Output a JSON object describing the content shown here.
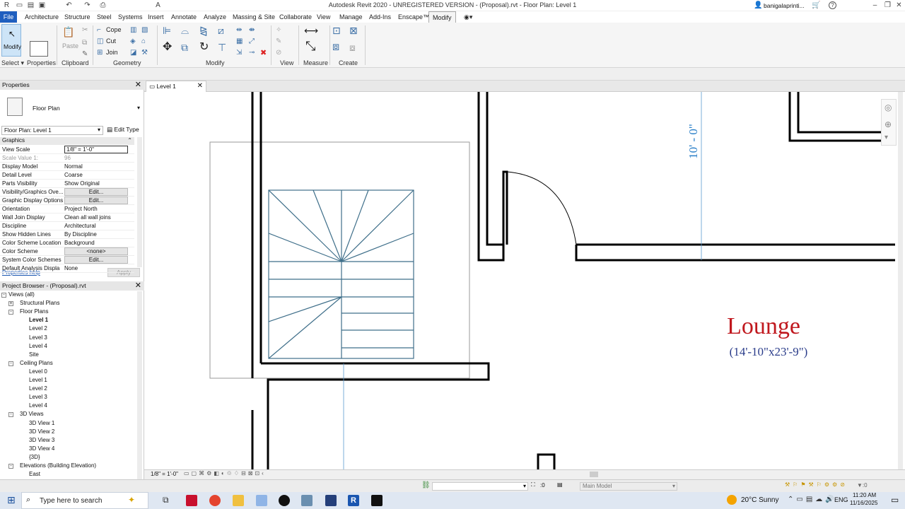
{
  "window": {
    "title": "Autodesk Revit 2020 - UNREGISTERED VERSION - (Proposal).rvt - Floor Plan: Level 1",
    "user": "banigalaprinti...",
    "help": "?"
  },
  "menu": [
    "File",
    "Architecture",
    "Structure",
    "Steel",
    "Systems",
    "Insert",
    "Annotate",
    "Analyze",
    "Massing & Site",
    "Collaborate",
    "View",
    "Manage",
    "Add-Ins",
    "Enscape™",
    "Modify"
  ],
  "ribbon": {
    "modify_label": "Modify",
    "select_label": "Select",
    "properties_label": "Properties",
    "paste_label": "Paste",
    "cope_label": "Cope",
    "cut_label": "Cut",
    "join_label": "Join",
    "panels": [
      "Clipboard",
      "Geometry",
      "Modify",
      "View",
      "Measure",
      "Create"
    ]
  },
  "properties": {
    "title": "Properties",
    "type_name": "Floor Plan",
    "instance": "Floor Plan: Level 1",
    "edit_type": "Edit Type",
    "group": "Graphics",
    "rows": [
      {
        "k": "View Scale",
        "v": "1/8\" = 1'-0\""
      },
      {
        "k": "Scale Value    1:",
        "v": "96"
      },
      {
        "k": "Display Model",
        "v": "Normal"
      },
      {
        "k": "Detail Level",
        "v": "Coarse"
      },
      {
        "k": "Parts Visibility",
        "v": "Show Original"
      },
      {
        "k": "Visibility/Graphics Ove...",
        "v": "Edit..."
      },
      {
        "k": "Graphic Display Options",
        "v": "Edit..."
      },
      {
        "k": "Orientation",
        "v": "Project North"
      },
      {
        "k": "Wall Join Display",
        "v": "Clean all wall joins"
      },
      {
        "k": "Discipline",
        "v": "Architectural"
      },
      {
        "k": "Show Hidden Lines",
        "v": "By Discipline"
      },
      {
        "k": "Color Scheme Location",
        "v": "Background"
      },
      {
        "k": "Color Scheme",
        "v": "<none>"
      },
      {
        "k": "System Color Schemes",
        "v": "Edit..."
      },
      {
        "k": "Default Analysis Displa",
        "v": "None"
      }
    ],
    "help_link": "Properties help",
    "apply": "Apply"
  },
  "browser": {
    "title": "Project Browser - (Proposal).rvt",
    "items": [
      {
        "t": "Views (all)",
        "lvl": 0,
        "tog": "-"
      },
      {
        "t": "Structural Plans",
        "lvl": 1,
        "tog": "+"
      },
      {
        "t": "Floor Plans",
        "lvl": 1,
        "tog": "-"
      },
      {
        "t": "Level 1",
        "lvl": 2,
        "bold": true
      },
      {
        "t": "Level 2",
        "lvl": 2
      },
      {
        "t": "Level 3",
        "lvl": 2
      },
      {
        "t": "Level 4",
        "lvl": 2
      },
      {
        "t": "Site",
        "lvl": 2
      },
      {
        "t": "Ceiling Plans",
        "lvl": 1,
        "tog": "-"
      },
      {
        "t": "Level 0",
        "lvl": 2
      },
      {
        "t": "Level 1",
        "lvl": 2
      },
      {
        "t": "Level 2",
        "lvl": 2
      },
      {
        "t": "Level 3",
        "lvl": 2
      },
      {
        "t": "Level 4",
        "lvl": 2
      },
      {
        "t": "3D Views",
        "lvl": 1,
        "tog": "-"
      },
      {
        "t": "3D View 1",
        "lvl": 2
      },
      {
        "t": "3D View 2",
        "lvl": 2
      },
      {
        "t": "3D View 3",
        "lvl": 2
      },
      {
        "t": "3D View 4",
        "lvl": 2
      },
      {
        "t": "{3D}",
        "lvl": 2
      },
      {
        "t": "Elevations (Building Elevation)",
        "lvl": 1,
        "tog": "-"
      },
      {
        "t": "East",
        "lvl": 2
      }
    ]
  },
  "view_tab": {
    "label": "Level 1"
  },
  "drawing": {
    "dimension": "10' - 0\"",
    "room_name": "Lounge",
    "room_size": "(14'-10\"x23'-9\")"
  },
  "viewbar": {
    "scale": "1/8\" = 1'-0\""
  },
  "status": {
    "selection_count": ":0",
    "model": "Main Model"
  },
  "taskbar": {
    "search_placeholder": "Type here to search",
    "weather": "20°C  Sunny",
    "lang": "ENG",
    "time": "11:20 AM",
    "date": "11/16/2025"
  },
  "colors": {
    "stair": "#3f6f8a",
    "room_name": "#c0181e",
    "room_size": "#2a3c8a",
    "dimension": "#2a7fc8",
    "file_tab": "#1f5fbf"
  }
}
